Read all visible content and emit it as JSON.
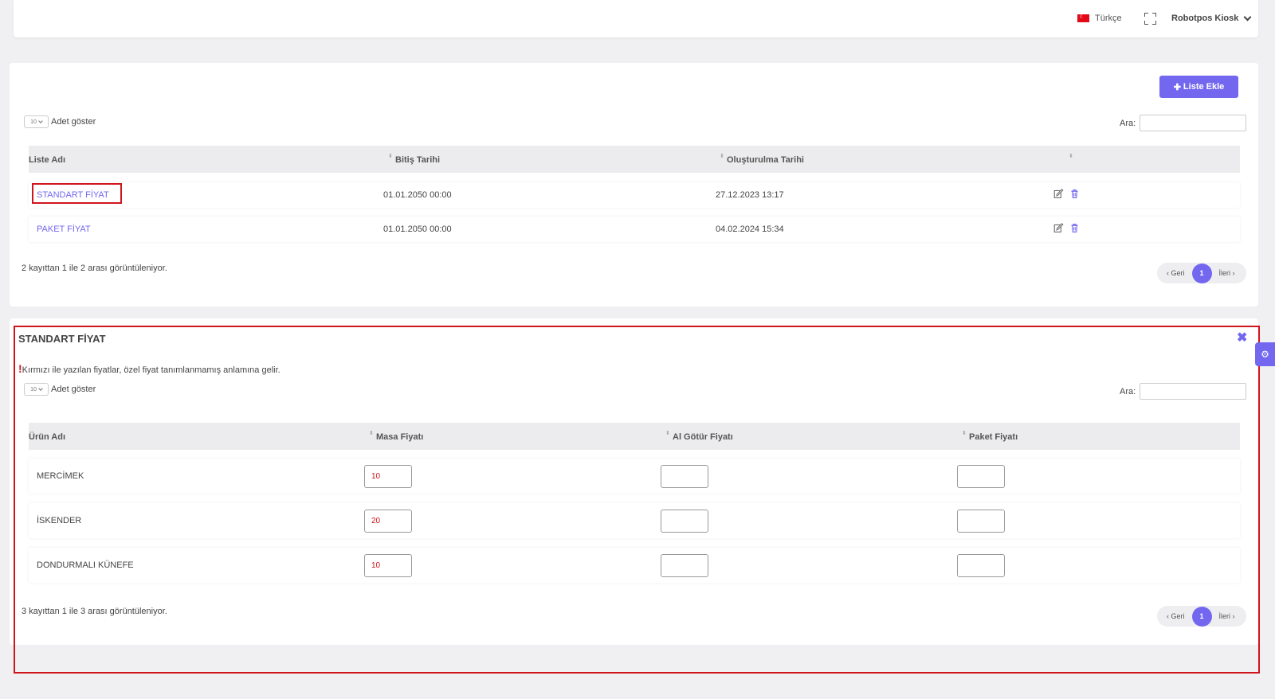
{
  "topbar": {
    "language": "Türkçe",
    "user": "Robotpos Kiosk"
  },
  "lists": {
    "add_button": "Liste Ekle",
    "length_value": "10",
    "length_label": "Adet göster",
    "search_label": "Ara:",
    "columns": [
      "Liste Adı",
      "Bitiş Tarihi",
      "Oluşturulma Tarihi"
    ],
    "rows": [
      {
        "name": "STANDART FİYAT",
        "end": "01.01.2050 00:00",
        "created": "27.12.2023 13:17"
      },
      {
        "name": "PAKET FİYAT",
        "end": "01.01.2050 00:00",
        "created": "04.02.2024 15:34"
      }
    ],
    "info": "2 kayıttan 1 ile 2 arası görüntüleniyor.",
    "pager": {
      "prev": "‹ Geri",
      "page": "1",
      "next": "İleri ›"
    }
  },
  "detail": {
    "title": "STANDART FİYAT",
    "notice": "Kırmızı ile yazılan fiyatlar, özel fiyat tanımlanmamış anlamına gelir.",
    "length_value": "10",
    "length_label": "Adet göster",
    "search_label": "Ara:",
    "columns": [
      "Ürün Adı",
      "Masa Fiyatı",
      "Al Götür Fiyatı",
      "Paket Fiyatı"
    ],
    "rows": [
      {
        "name": "MERCİMEK",
        "masa": "10",
        "algotur": "",
        "paket": ""
      },
      {
        "name": "İSKENDER",
        "masa": "20",
        "algotur": "",
        "paket": ""
      },
      {
        "name": "DONDURMALI KÜNEFE",
        "masa": "10",
        "algotur": "",
        "paket": ""
      }
    ],
    "info": "3 kayıttan 1 ile 3 arası görüntüleniyor.",
    "pager": {
      "prev": "‹ Geri",
      "page": "1",
      "next": "İleri ›"
    }
  },
  "colors": {
    "accent": "#7367f0",
    "highlight": "#d0141c"
  }
}
